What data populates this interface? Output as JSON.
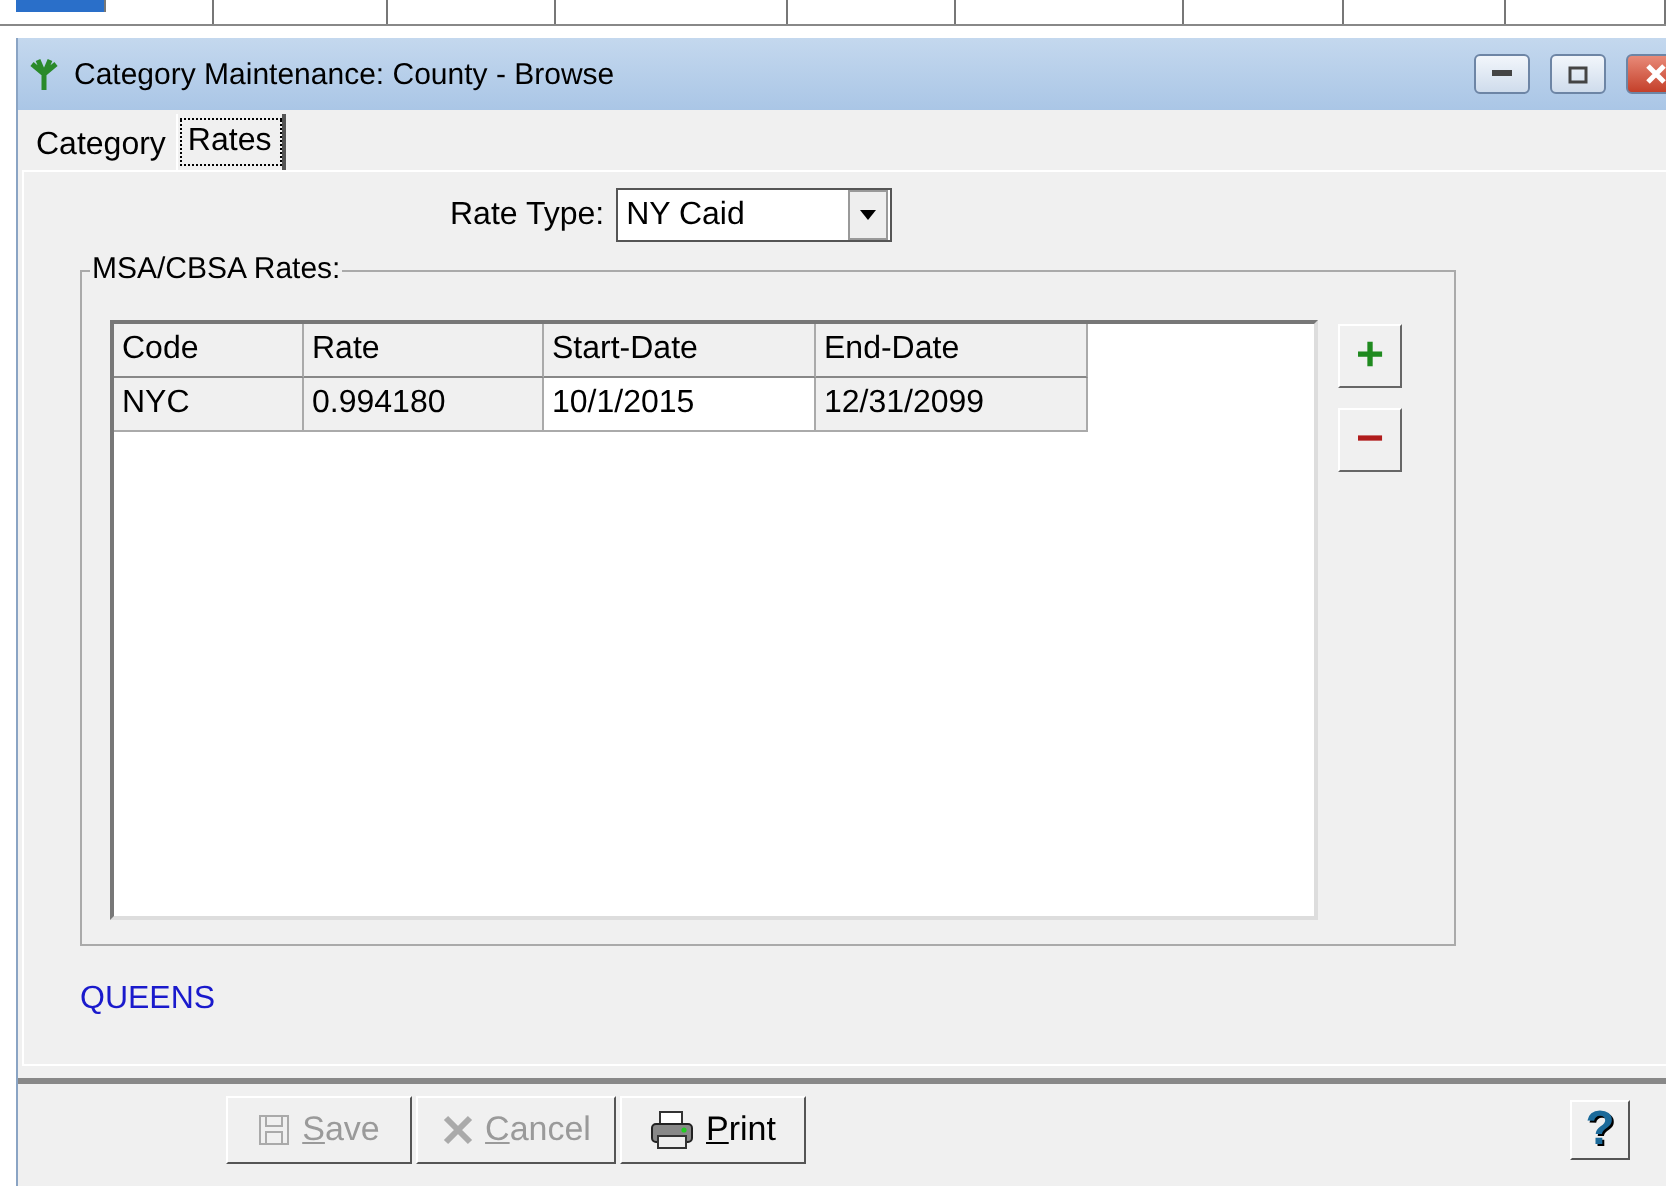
{
  "window": {
    "title": "Category Maintenance: County - Browse"
  },
  "tabs": [
    {
      "label": "Category",
      "selected": false
    },
    {
      "label": "Rates",
      "selected": true
    }
  ],
  "rate_type": {
    "label": "Rate Type:",
    "value": "NY Caid"
  },
  "group": {
    "title": "MSA/CBSA Rates:"
  },
  "table": {
    "columns": [
      "Code",
      "Rate",
      "Start-Date",
      "End-Date"
    ],
    "rows": [
      [
        "NYC",
        "0.994180",
        "10/1/2015",
        "12/31/2099"
      ]
    ]
  },
  "side_buttons": [
    {
      "kind": "add",
      "label": "+"
    },
    {
      "kind": "remove",
      "label": "−"
    }
  ],
  "county_name": "QUEENS",
  "footer": {
    "buttons": [
      {
        "kind": "save",
        "label": "Save",
        "disabled": true
      },
      {
        "kind": "cancel",
        "label": "Cancel",
        "disabled": true
      },
      {
        "kind": "print",
        "label": "Print",
        "disabled": false
      }
    ],
    "help": "?"
  }
}
